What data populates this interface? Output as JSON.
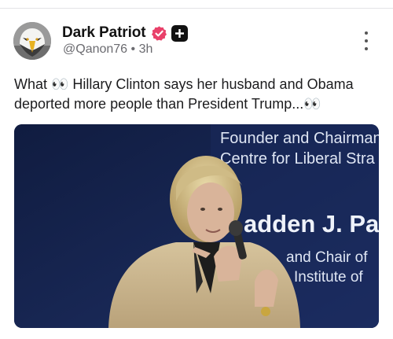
{
  "post": {
    "display_name": "Dark Patriot",
    "handle": "@Qanon76",
    "separator": "•",
    "time": "3h",
    "text": "What 👀 Hillary Clinton says her husband and Obama deported more people than President Trump...👀"
  },
  "media": {
    "screen_lines": [
      "Founder and Chairman",
      "Centre for Liberal Stra",
      "adden J. Pa",
      "and Chair of",
      "Institute of"
    ]
  },
  "icons": {
    "verified": "verified-badge-icon",
    "plus": "plus-badge-icon",
    "more": "more-vertical-icon"
  },
  "colors": {
    "verified_badge": "#e9416a",
    "video_background": "#16244e"
  }
}
